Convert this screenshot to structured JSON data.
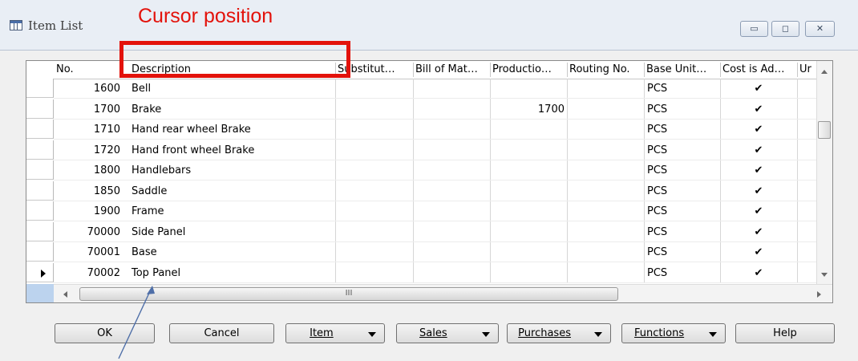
{
  "window": {
    "title": "Item List",
    "annotation": "Cursor position"
  },
  "title_buttons": {
    "minimize": "▭",
    "maximize": "◻",
    "close": "✕"
  },
  "columns": [
    "No.",
    "Description",
    "Substitut…",
    "Bill of Mat…",
    "Productio…",
    "Routing No.",
    "Base Unit…",
    "Cost is Ad…",
    "Ur"
  ],
  "rows": [
    {
      "no": "1600",
      "description": "Bell",
      "production_bom": "",
      "base_unit": "PCS",
      "cost_adjusted": "✔"
    },
    {
      "no": "1700",
      "description": "Brake",
      "production_bom": "1700",
      "base_unit": "PCS",
      "cost_adjusted": "✔"
    },
    {
      "no": "1710",
      "description": "Hand rear wheel Brake",
      "production_bom": "",
      "base_unit": "PCS",
      "cost_adjusted": "✔"
    },
    {
      "no": "1720",
      "description": "Hand front wheel Brake",
      "production_bom": "",
      "base_unit": "PCS",
      "cost_adjusted": "✔"
    },
    {
      "no": "1800",
      "description": "Handlebars",
      "production_bom": "",
      "base_unit": "PCS",
      "cost_adjusted": "✔"
    },
    {
      "no": "1850",
      "description": "Saddle",
      "production_bom": "",
      "base_unit": "PCS",
      "cost_adjusted": "✔"
    },
    {
      "no": "1900",
      "description": "Frame",
      "production_bom": "",
      "base_unit": "PCS",
      "cost_adjusted": "✔"
    },
    {
      "no": "70000",
      "description": "Side Panel",
      "production_bom": "",
      "base_unit": "PCS",
      "cost_adjusted": "✔"
    },
    {
      "no": "70001",
      "description": "Base",
      "production_bom": "",
      "base_unit": "PCS",
      "cost_adjusted": "✔"
    },
    {
      "no": "70002",
      "description": "Top Panel",
      "production_bom": "",
      "base_unit": "PCS",
      "cost_adjusted": "✔"
    }
  ],
  "scrollbar_grip": "III",
  "buttons": {
    "ok": "OK",
    "cancel": "Cancel",
    "item": "Item",
    "sales": "Sales",
    "purchases": "Purchases",
    "functions": "Functions",
    "help": "Help"
  },
  "colors": {
    "annotation": "#e3120b",
    "arrow": "#4f6fa8",
    "selector_corner": "#bcd3ee"
  }
}
